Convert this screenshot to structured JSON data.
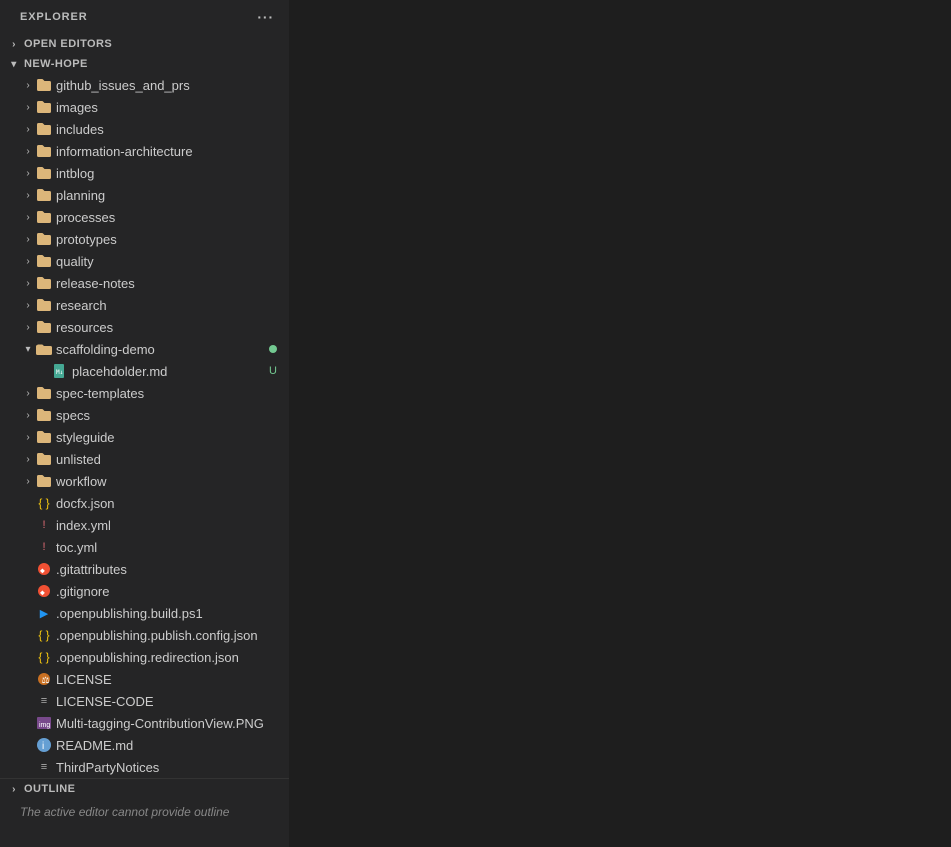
{
  "explorer": {
    "header_label": "EXPLORER",
    "more_icon": "···",
    "sections": {
      "open_editors": {
        "label": "OPEN EDITORS",
        "collapsed": true
      },
      "new_hope": {
        "label": "NEW-HOPE",
        "expanded": true
      },
      "outline": {
        "label": "OUTLINE",
        "collapsed": true,
        "message": "The active editor cannot provide outline"
      }
    }
  },
  "tree": {
    "folders": [
      {
        "id": "github_issues_and_prs",
        "label": "github_issues_and_prs",
        "indent": 1,
        "expanded": false
      },
      {
        "id": "images",
        "label": "images",
        "indent": 1,
        "expanded": false
      },
      {
        "id": "includes",
        "label": "includes",
        "indent": 1,
        "expanded": false
      },
      {
        "id": "information-architecture",
        "label": "information-architecture",
        "indent": 1,
        "expanded": false
      },
      {
        "id": "intblog",
        "label": "intblog",
        "indent": 1,
        "expanded": false
      },
      {
        "id": "planning",
        "label": "planning",
        "indent": 1,
        "expanded": false
      },
      {
        "id": "processes",
        "label": "processes",
        "indent": 1,
        "expanded": false
      },
      {
        "id": "prototypes",
        "label": "prototypes",
        "indent": 1,
        "expanded": false
      },
      {
        "id": "quality",
        "label": "quality",
        "indent": 1,
        "expanded": false
      },
      {
        "id": "release-notes",
        "label": "release-notes",
        "indent": 1,
        "expanded": false
      },
      {
        "id": "research",
        "label": "research",
        "indent": 1,
        "expanded": false
      },
      {
        "id": "resources",
        "label": "resources",
        "indent": 1,
        "expanded": false
      },
      {
        "id": "scaffolding-demo",
        "label": "scaffolding-demo",
        "indent": 1,
        "expanded": true,
        "dot": true
      },
      {
        "id": "spec-templates",
        "label": "spec-templates",
        "indent": 1,
        "expanded": false
      },
      {
        "id": "specs",
        "label": "specs",
        "indent": 1,
        "expanded": false
      },
      {
        "id": "styleguide",
        "label": "styleguide",
        "indent": 1,
        "expanded": false
      },
      {
        "id": "unlisted",
        "label": "unlisted",
        "indent": 1,
        "expanded": false
      },
      {
        "id": "workflow",
        "label": "workflow",
        "indent": 1,
        "expanded": false
      }
    ],
    "files": [
      {
        "id": "placehdolder-md",
        "label": "placehdolder.md",
        "indent": 2,
        "type": "md",
        "badge": "U"
      },
      {
        "id": "docfx-json",
        "label": "docfx.json",
        "indent": 1,
        "type": "json"
      },
      {
        "id": "index-yml",
        "label": "index.yml",
        "indent": 1,
        "type": "yaml"
      },
      {
        "id": "toc-yml",
        "label": "toc.yml",
        "indent": 1,
        "type": "yaml"
      },
      {
        "id": "gitattributes",
        "label": ".gitattributes",
        "indent": 1,
        "type": "git"
      },
      {
        "id": "gitignore",
        "label": ".gitignore",
        "indent": 1,
        "type": "git"
      },
      {
        "id": "openpublishing-build-ps1",
        "label": ".openpublishing.build.ps1",
        "indent": 1,
        "type": "ps1"
      },
      {
        "id": "openpublishing-publish-config-json",
        "label": ".openpublishing.publish.config.json",
        "indent": 1,
        "type": "json"
      },
      {
        "id": "openpublishing-redirection-json",
        "label": ".openpublishing.redirection.json",
        "indent": 1,
        "type": "json"
      },
      {
        "id": "license",
        "label": "LICENSE",
        "indent": 1,
        "type": "license"
      },
      {
        "id": "license-code",
        "label": "LICENSE-CODE",
        "indent": 1,
        "type": "txt"
      },
      {
        "id": "multi-tagging-png",
        "label": "Multi-tagging-ContributionView.PNG",
        "indent": 1,
        "type": "png"
      },
      {
        "id": "readme-md",
        "label": "README.md",
        "indent": 1,
        "type": "info"
      },
      {
        "id": "thirdpartynotices",
        "label": "ThirdPartyNotices",
        "indent": 1,
        "type": "txt"
      }
    ]
  }
}
